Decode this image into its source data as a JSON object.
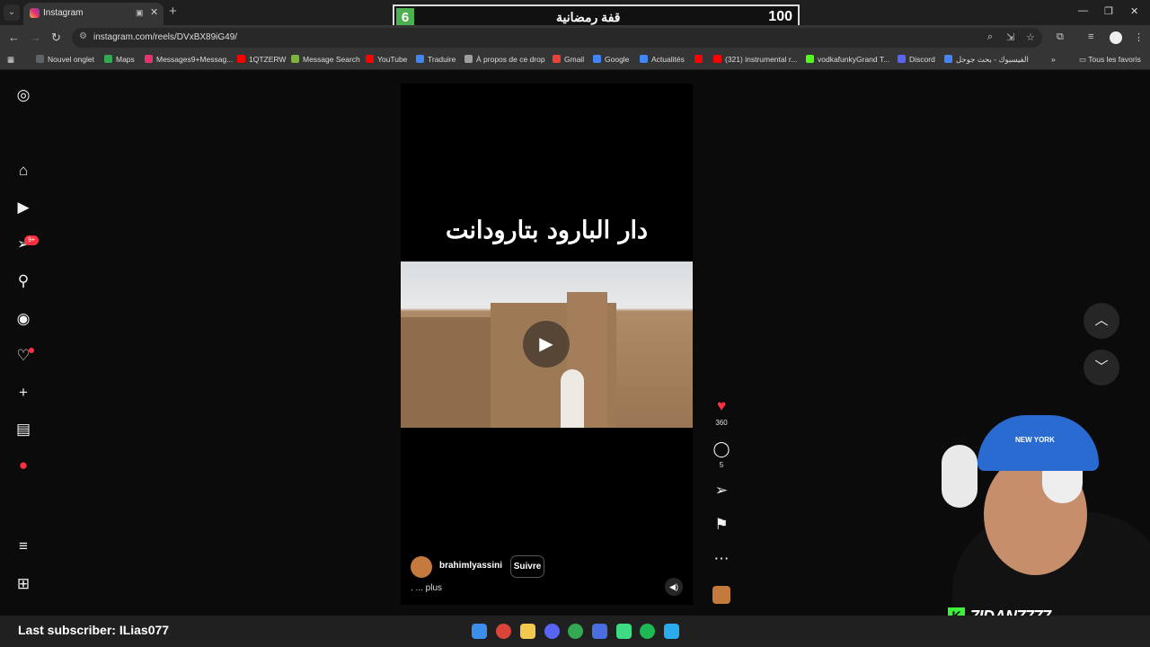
{
  "browser": {
    "tab_title": "Instagram",
    "url": "instagram.com/reels/DVxBX89iG49/",
    "bookmarks": [
      {
        "label": "Nouvel onglet",
        "color": "#5f6368"
      },
      {
        "label": "Maps",
        "color": "#34a853"
      },
      {
        "label": "Messages9+Messag...",
        "color": "#e6336f"
      },
      {
        "label": "1QTZERW",
        "color": "#ff0000"
      },
      {
        "label": "Message Search",
        "color": "#7cb342"
      },
      {
        "label": "YouTube",
        "color": "#ff0000"
      },
      {
        "label": "Traduire",
        "color": "#4285f4"
      },
      {
        "label": "À propos de ce drop",
        "color": "#9e9e9e"
      },
      {
        "label": "Gmail",
        "color": "#ea4335"
      },
      {
        "label": "Google",
        "color": "#4285f4"
      },
      {
        "label": "Actualités",
        "color": "#4285f4"
      },
      {
        "label": "",
        "color": "#ff0000"
      },
      {
        "label": "(321) instrumental r...",
        "color": "#ff0000"
      },
      {
        "label": "vodkafunkyGrand T...",
        "color": "#53fc18"
      },
      {
        "label": "Discord",
        "color": "#5865f2"
      },
      {
        "label": "الفيسبوك - بحث جوجل",
        "color": "#4285f4"
      }
    ],
    "all_bookmarks": "Tous les favoris"
  },
  "score_overlay": {
    "level": "6",
    "label": "قفة رمضانية",
    "points": "100"
  },
  "reel": {
    "title_text": "دار البارود بتارودانت",
    "username": "brahimlyassini",
    "follow_label": "Suivre",
    "caption_more": ". ... plus",
    "likes": "360",
    "comments": "5"
  },
  "stream": {
    "last_subscriber": "Last subscriber: ILias077",
    "channel_name": "7IDAN7777",
    "cap_text": "NEW YORK",
    "notif_badge": "9+"
  },
  "icons": {
    "instagram": "instagram-logo-icon",
    "home": "home-icon",
    "reels": "reels-icon",
    "messages": "paper-plane-icon",
    "search": "search-icon",
    "explore": "compass-icon",
    "notifications": "heart-icon",
    "create": "plus-icon",
    "dashboard": "chart-icon",
    "menu": "hamburger-icon",
    "apps": "apps-icon"
  },
  "colors": {
    "accent_red": "#ff3040",
    "kick_green": "#3ef03a",
    "score_green": "#4caf50"
  }
}
